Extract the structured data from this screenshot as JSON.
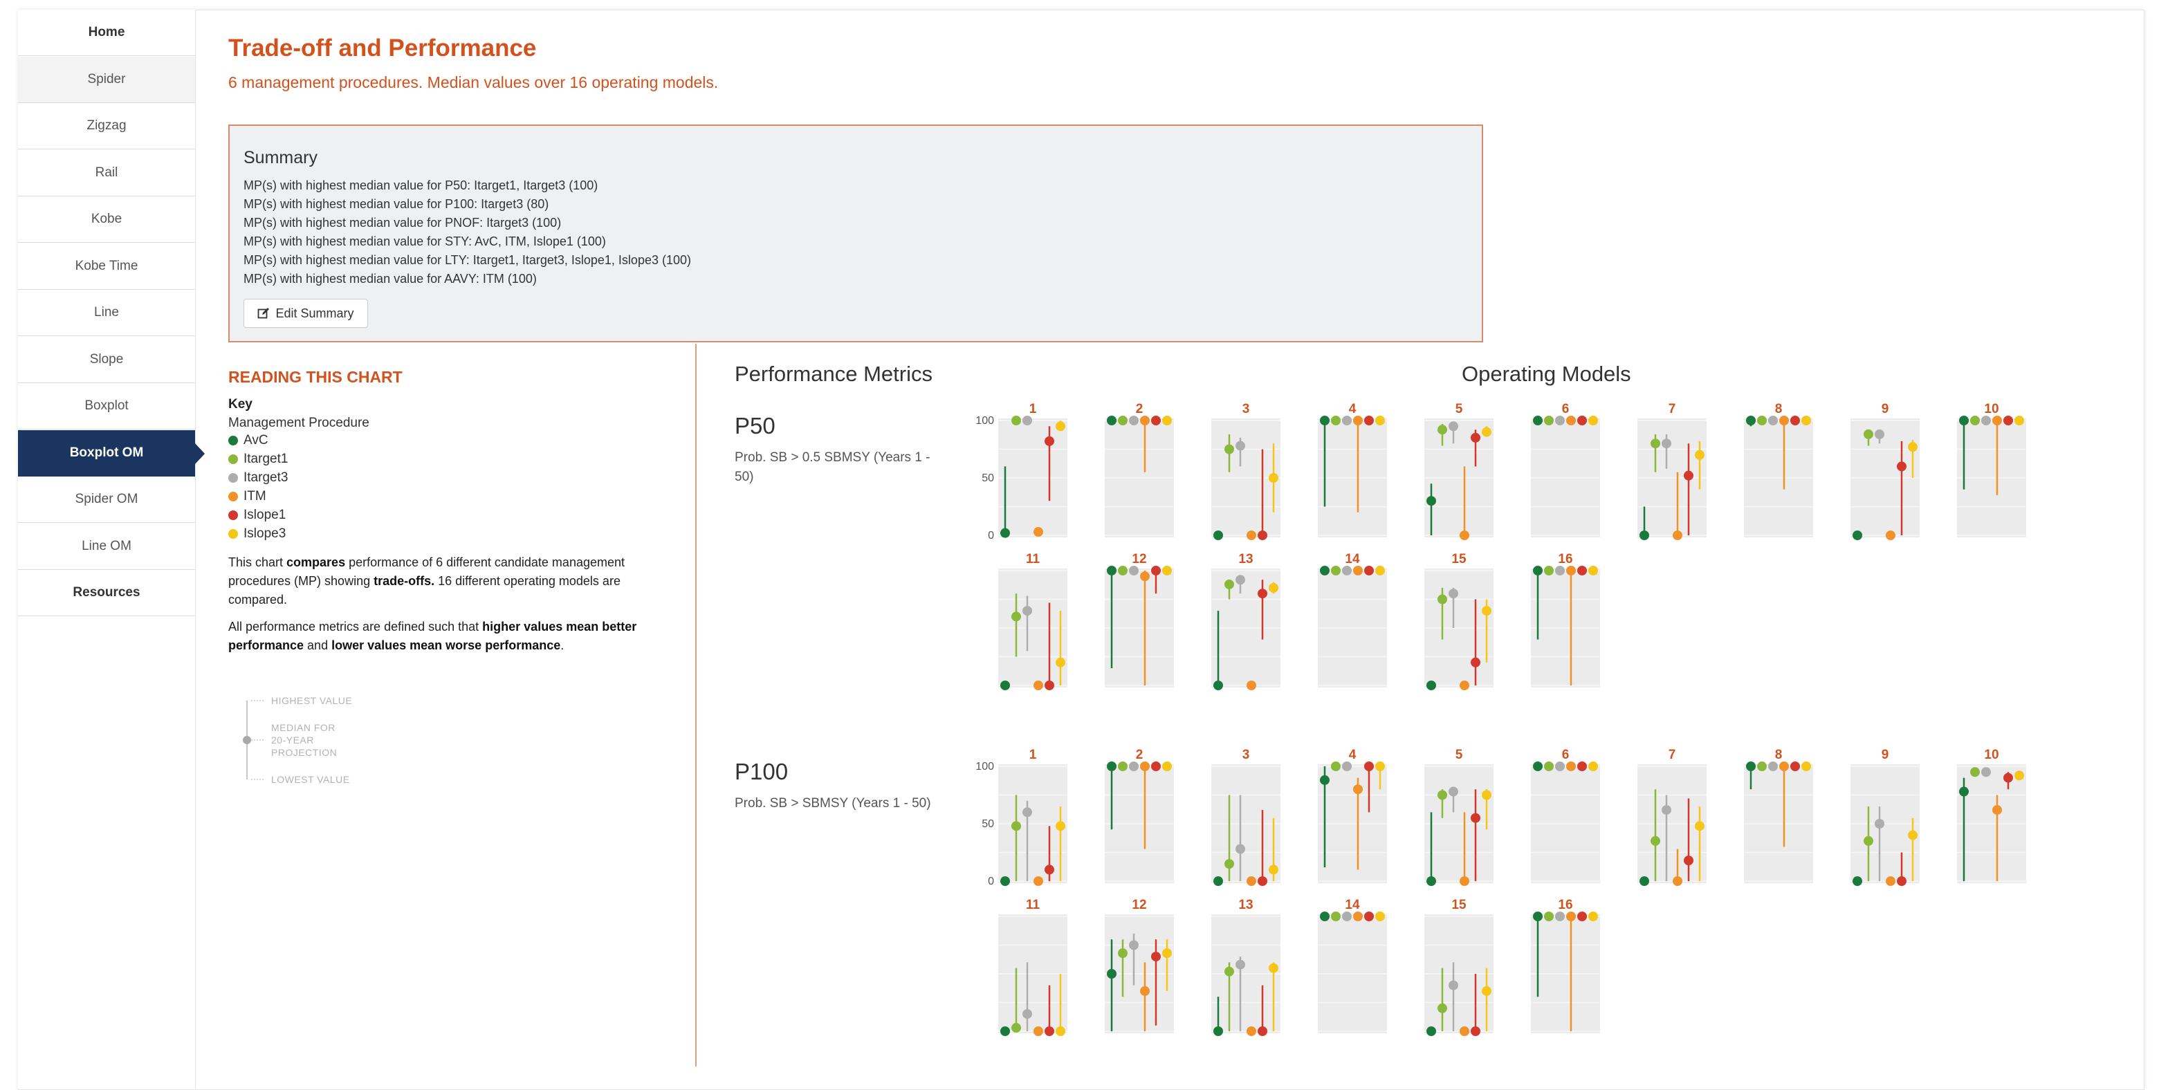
{
  "sidebar": {
    "items": [
      {
        "label": "Home",
        "bold": true,
        "shaded": false,
        "active": false
      },
      {
        "label": "Spider",
        "bold": false,
        "shaded": true,
        "active": false
      },
      {
        "label": "Zigzag",
        "bold": false,
        "shaded": false,
        "active": false
      },
      {
        "label": "Rail",
        "bold": false,
        "shaded": false,
        "active": false
      },
      {
        "label": "Kobe",
        "bold": false,
        "shaded": false,
        "active": false
      },
      {
        "label": "Kobe Time",
        "bold": false,
        "shaded": false,
        "active": false
      },
      {
        "label": "Line",
        "bold": false,
        "shaded": false,
        "active": false
      },
      {
        "label": "Slope",
        "bold": false,
        "shaded": false,
        "active": false
      },
      {
        "label": "Boxplot",
        "bold": false,
        "shaded": false,
        "active": false
      },
      {
        "label": "Boxplot OM",
        "bold": false,
        "shaded": false,
        "active": true
      },
      {
        "label": "Spider OM",
        "bold": false,
        "shaded": false,
        "active": false
      },
      {
        "label": "Line OM",
        "bold": false,
        "shaded": false,
        "active": false
      },
      {
        "label": "Resources",
        "bold": true,
        "shaded": false,
        "active": false
      }
    ]
  },
  "header": {
    "title": "Trade-off and Performance",
    "subtitle": "6 management procedures. Median values over 16 operating models."
  },
  "summary": {
    "heading": "Summary",
    "lines": [
      "MP(s) with highest median value for P50: Itarget1, Itarget3 (100)",
      "MP(s) with highest median value for P100: Itarget3 (80)",
      "MP(s) with highest median value for PNOF: Itarget3 (100)",
      "MP(s) with highest median value for STY: AvC, ITM, Islope1 (100)",
      "MP(s) with highest median value for LTY: Itarget1, Itarget3, Islope1, Islope3 (100)",
      "MP(s) with highest median value for AAVY: ITM (100)"
    ],
    "edit_label": "Edit Summary",
    "edit_icon": "edit-icon"
  },
  "reading": {
    "title": "READING THIS CHART",
    "key_label": "Key",
    "mp_label": "Management Procedure",
    "para1": {
      "t1": "This chart ",
      "b1": "compares",
      "t2": " performance of 6 different candidate management procedures (MP) showing ",
      "b2": "trade-offs.",
      "t3": " 16 different operating models are compared."
    },
    "para2": {
      "t1": "All performance metrics are defined such that ",
      "b1": "higher values mean better performance",
      "t2": " and ",
      "b2": "lower values mean worse performance",
      "t3": "."
    },
    "mini_legend": {
      "highest": "HIGHEST VALUE",
      "median_1": "MEDIAN FOR",
      "median_2": "20-YEAR",
      "median_3": "PROJECTION",
      "lowest": "LOWEST VALUE"
    }
  },
  "performance": {
    "heading": "Performance Metrics",
    "om_heading": "Operating Models",
    "metrics": [
      {
        "name": "P50",
        "desc": "Prob. SB > 0.5 SBMSY (Years 1 - 50)"
      },
      {
        "name": "P100",
        "desc": "Prob. SB > SBMSY (Years 1 - 50)"
      }
    ]
  },
  "chart_data": {
    "type": "boxplot",
    "title": "",
    "ylim": [
      0,
      100
    ],
    "yticks": [
      0,
      50,
      100
    ],
    "series_names": [
      "AvC",
      "Itarget1",
      "Itarget3",
      "ITM",
      "Islope1",
      "Islope3"
    ],
    "colors": [
      "#1a7a3c",
      "#8ab83a",
      "#adadad",
      "#f0912a",
      "#d0392b",
      "#f5c518"
    ],
    "operating_models": [
      "1",
      "2",
      "3",
      "4",
      "5",
      "6",
      "7",
      "8",
      "9",
      "10",
      "11",
      "12",
      "13",
      "14",
      "15",
      "16"
    ],
    "metrics": [
      {
        "name": "P50",
        "panels": [
          {
            "om": "1",
            "median": [
              2,
              100,
              100,
              3,
              82,
              95
            ],
            "low": [
              0,
              100,
              100,
              0,
              30,
              93
            ],
            "high": [
              60,
              100,
              100,
              3,
              95,
              100
            ]
          },
          {
            "om": "2",
            "median": [
              100,
              100,
              100,
              100,
              100,
              100
            ],
            "low": [
              100,
              100,
              100,
              55,
              100,
              100
            ],
            "high": [
              100,
              100,
              100,
              100,
              100,
              100
            ]
          },
          {
            "om": "3",
            "median": [
              0,
              75,
              78,
              0,
              0,
              50
            ],
            "low": [
              0,
              55,
              60,
              0,
              0,
              20
            ],
            "high": [
              0,
              88,
              85,
              0,
              75,
              80
            ]
          },
          {
            "om": "4",
            "median": [
              100,
              100,
              100,
              100,
              100,
              100
            ],
            "low": [
              25,
              100,
              100,
              20,
              100,
              100
            ],
            "high": [
              100,
              100,
              100,
              100,
              100,
              100
            ]
          },
          {
            "om": "5",
            "median": [
              30,
              92,
              95,
              0,
              85,
              90
            ],
            "low": [
              0,
              78,
              80,
              0,
              60,
              90
            ],
            "high": [
              45,
              97,
              98,
              60,
              92,
              95
            ]
          },
          {
            "om": "6",
            "median": [
              100,
              100,
              100,
              100,
              100,
              100
            ],
            "low": [
              100,
              100,
              100,
              100,
              100,
              100
            ],
            "high": [
              100,
              100,
              100,
              100,
              100,
              100
            ]
          },
          {
            "om": "7",
            "median": [
              0,
              80,
              80,
              0,
              52,
              70
            ],
            "low": [
              0,
              55,
              58,
              0,
              0,
              40
            ],
            "high": [
              25,
              88,
              88,
              55,
              80,
              82
            ]
          },
          {
            "om": "8",
            "median": [
              100,
              100,
              100,
              100,
              100,
              100
            ],
            "low": [
              95,
              100,
              100,
              40,
              100,
              100
            ],
            "high": [
              100,
              100,
              100,
              100,
              100,
              100
            ]
          },
          {
            "om": "9",
            "median": [
              0,
              88,
              88,
              0,
              60,
              77
            ],
            "low": [
              0,
              78,
              80,
              0,
              0,
              50
            ],
            "high": [
              0,
              92,
              92,
              0,
              82,
              83
            ]
          },
          {
            "om": "10",
            "median": [
              100,
              100,
              100,
              100,
              100,
              100
            ],
            "low": [
              40,
              100,
              100,
              35,
              100,
              100
            ],
            "high": [
              100,
              100,
              100,
              100,
              100,
              100
            ]
          },
          {
            "om": "11",
            "median": [
              0,
              60,
              65,
              0,
              0,
              20
            ],
            "low": [
              0,
              25,
              30,
              0,
              0,
              0
            ],
            "high": [
              0,
              80,
              78,
              0,
              72,
              65
            ]
          },
          {
            "om": "12",
            "median": [
              100,
              100,
              100,
              95,
              100,
              100
            ],
            "low": [
              15,
              100,
              100,
              0,
              80,
              100
            ],
            "high": [
              100,
              100,
              100,
              100,
              100,
              100
            ]
          },
          {
            "om": "13",
            "median": [
              0,
              88,
              92,
              0,
              80,
              85
            ],
            "low": [
              0,
              75,
              80,
              0,
              40,
              80
            ],
            "high": [
              65,
              92,
              95,
              0,
              92,
              90
            ]
          },
          {
            "om": "14",
            "median": [
              100,
              100,
              100,
              100,
              100,
              100
            ],
            "low": [
              100,
              100,
              100,
              100,
              100,
              100
            ],
            "high": [
              100,
              100,
              100,
              100,
              100,
              100
            ]
          },
          {
            "om": "15",
            "median": [
              0,
              75,
              80,
              0,
              20,
              65
            ],
            "low": [
              0,
              40,
              50,
              0,
              0,
              20
            ],
            "high": [
              0,
              85,
              85,
              0,
              75,
              75
            ]
          },
          {
            "om": "16",
            "median": [
              100,
              100,
              100,
              100,
              100,
              100
            ],
            "low": [
              40,
              100,
              100,
              0,
              100,
              100
            ],
            "high": [
              100,
              100,
              100,
              100,
              100,
              100
            ]
          }
        ]
      },
      {
        "name": "P100",
        "panels": [
          {
            "om": "1",
            "median": [
              0,
              48,
              60,
              0,
              10,
              48
            ],
            "low": [
              0,
              0,
              0,
              0,
              0,
              0
            ],
            "high": [
              0,
              75,
              70,
              0,
              48,
              65
            ]
          },
          {
            "om": "2",
            "median": [
              100,
              100,
              100,
              100,
              100,
              100
            ],
            "low": [
              45,
              100,
              100,
              28,
              100,
              100
            ],
            "high": [
              100,
              100,
              100,
              100,
              100,
              100
            ]
          },
          {
            "om": "3",
            "median": [
              0,
              15,
              28,
              0,
              0,
              10
            ],
            "low": [
              0,
              0,
              0,
              0,
              0,
              0
            ],
            "high": [
              0,
              75,
              75,
              0,
              62,
              55
            ]
          },
          {
            "om": "4",
            "median": [
              88,
              100,
              100,
              80,
              100,
              100
            ],
            "low": [
              12,
              100,
              100,
              10,
              60,
              80
            ],
            "high": [
              100,
              100,
              100,
              90,
              100,
              100
            ]
          },
          {
            "om": "5",
            "median": [
              0,
              75,
              78,
              0,
              55,
              75
            ],
            "low": [
              0,
              55,
              60,
              0,
              0,
              45
            ],
            "high": [
              60,
              80,
              82,
              60,
              80,
              80
            ]
          },
          {
            "om": "6",
            "median": [
              100,
              100,
              100,
              100,
              100,
              100
            ],
            "low": [
              100,
              100,
              100,
              100,
              100,
              100
            ],
            "high": [
              100,
              100,
              100,
              100,
              100,
              100
            ]
          },
          {
            "om": "7",
            "median": [
              0,
              35,
              62,
              0,
              18,
              48
            ],
            "low": [
              0,
              0,
              0,
              0,
              0,
              0
            ],
            "high": [
              0,
              80,
              75,
              28,
              72,
              65
            ]
          },
          {
            "om": "8",
            "median": [
              100,
              100,
              100,
              100,
              100,
              100
            ],
            "low": [
              80,
              100,
              100,
              30,
              100,
              100
            ],
            "high": [
              100,
              100,
              100,
              100,
              100,
              100
            ]
          },
          {
            "om": "9",
            "median": [
              0,
              35,
              50,
              0,
              0,
              40
            ],
            "low": [
              0,
              0,
              0,
              0,
              0,
              0
            ],
            "high": [
              0,
              65,
              65,
              0,
              25,
              55
            ]
          },
          {
            "om": "10",
            "median": [
              78,
              95,
              95,
              62,
              90,
              92
            ],
            "low": [
              0,
              95,
              95,
              0,
              80,
              90
            ],
            "high": [
              90,
              98,
              98,
              75,
              95,
              95
            ]
          },
          {
            "om": "11",
            "median": [
              0,
              3,
              15,
              0,
              0,
              0
            ],
            "low": [
              0,
              0,
              0,
              0,
              0,
              0
            ],
            "high": [
              0,
              55,
              60,
              0,
              40,
              50
            ]
          },
          {
            "om": "12",
            "median": [
              50,
              68,
              75,
              35,
              65,
              68
            ],
            "low": [
              0,
              30,
              40,
              0,
              5,
              35
            ],
            "high": [
              80,
              80,
              85,
              60,
              80,
              80
            ]
          },
          {
            "om": "13",
            "median": [
              0,
              52,
              58,
              0,
              0,
              55
            ],
            "low": [
              0,
              0,
              0,
              0,
              0,
              0
            ],
            "high": [
              30,
              60,
              65,
              0,
              40,
              60
            ]
          },
          {
            "om": "14",
            "median": [
              100,
              100,
              100,
              100,
              100,
              100
            ],
            "low": [
              100,
              100,
              100,
              100,
              100,
              100
            ],
            "high": [
              100,
              100,
              100,
              100,
              100,
              100
            ]
          },
          {
            "om": "15",
            "median": [
              0,
              20,
              40,
              0,
              0,
              35
            ],
            "low": [
              0,
              0,
              0,
              0,
              0,
              0
            ],
            "high": [
              0,
              55,
              60,
              0,
              50,
              55
            ]
          },
          {
            "om": "16",
            "median": [
              100,
              100,
              100,
              100,
              100,
              100
            ],
            "low": [
              30,
              100,
              100,
              0,
              100,
              100
            ],
            "high": [
              100,
              100,
              100,
              100,
              100,
              100
            ]
          }
        ]
      }
    ]
  }
}
